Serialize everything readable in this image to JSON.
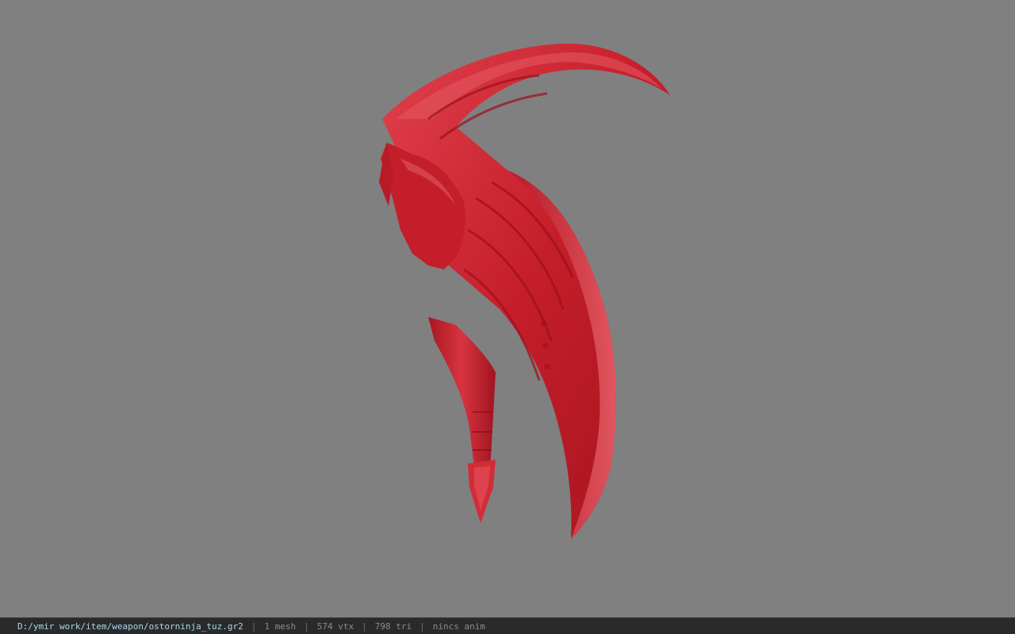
{
  "statusbar": {
    "file_path": "D:/ymir work/item/weapon/ostorninja_tuz.gr2",
    "separator": "|",
    "mesh_count": "1 mesh",
    "vertex_count": "574 vtx",
    "triangle_count": "798 tri",
    "animation_status": "nincs anim"
  },
  "viewport": {
    "background_color": "#808080",
    "model_color": "#c8202c",
    "model_icon": "red-scythe-blade-model"
  }
}
